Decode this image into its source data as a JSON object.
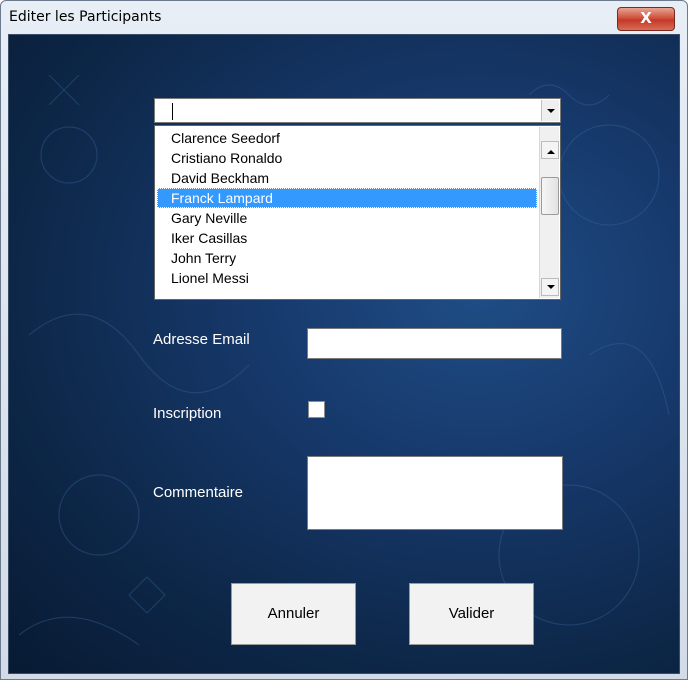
{
  "window": {
    "title": "Editer les Participants",
    "close_glyph": "X"
  },
  "combo": {
    "value": "",
    "arrow_icon": "chevron-down-icon"
  },
  "participants": {
    "items": [
      "Clarence Seedorf",
      "Cristiano Ronaldo",
      "David Beckham",
      "Franck Lampard",
      "Gary Neville",
      "Iker Casillas",
      "John Terry",
      "Lionel Messi"
    ],
    "selected": "Franck Lampard"
  },
  "form": {
    "email_label": "Adresse Email",
    "email_value": "",
    "inscription_label": "Inscription",
    "inscription_checked": false,
    "comment_label": "Commentaire",
    "comment_value": ""
  },
  "buttons": {
    "cancel": "Annuler",
    "submit": "Valider"
  },
  "colors": {
    "selection": "#3399ff",
    "close_button": "#c8452f",
    "background": "#0d2748"
  }
}
